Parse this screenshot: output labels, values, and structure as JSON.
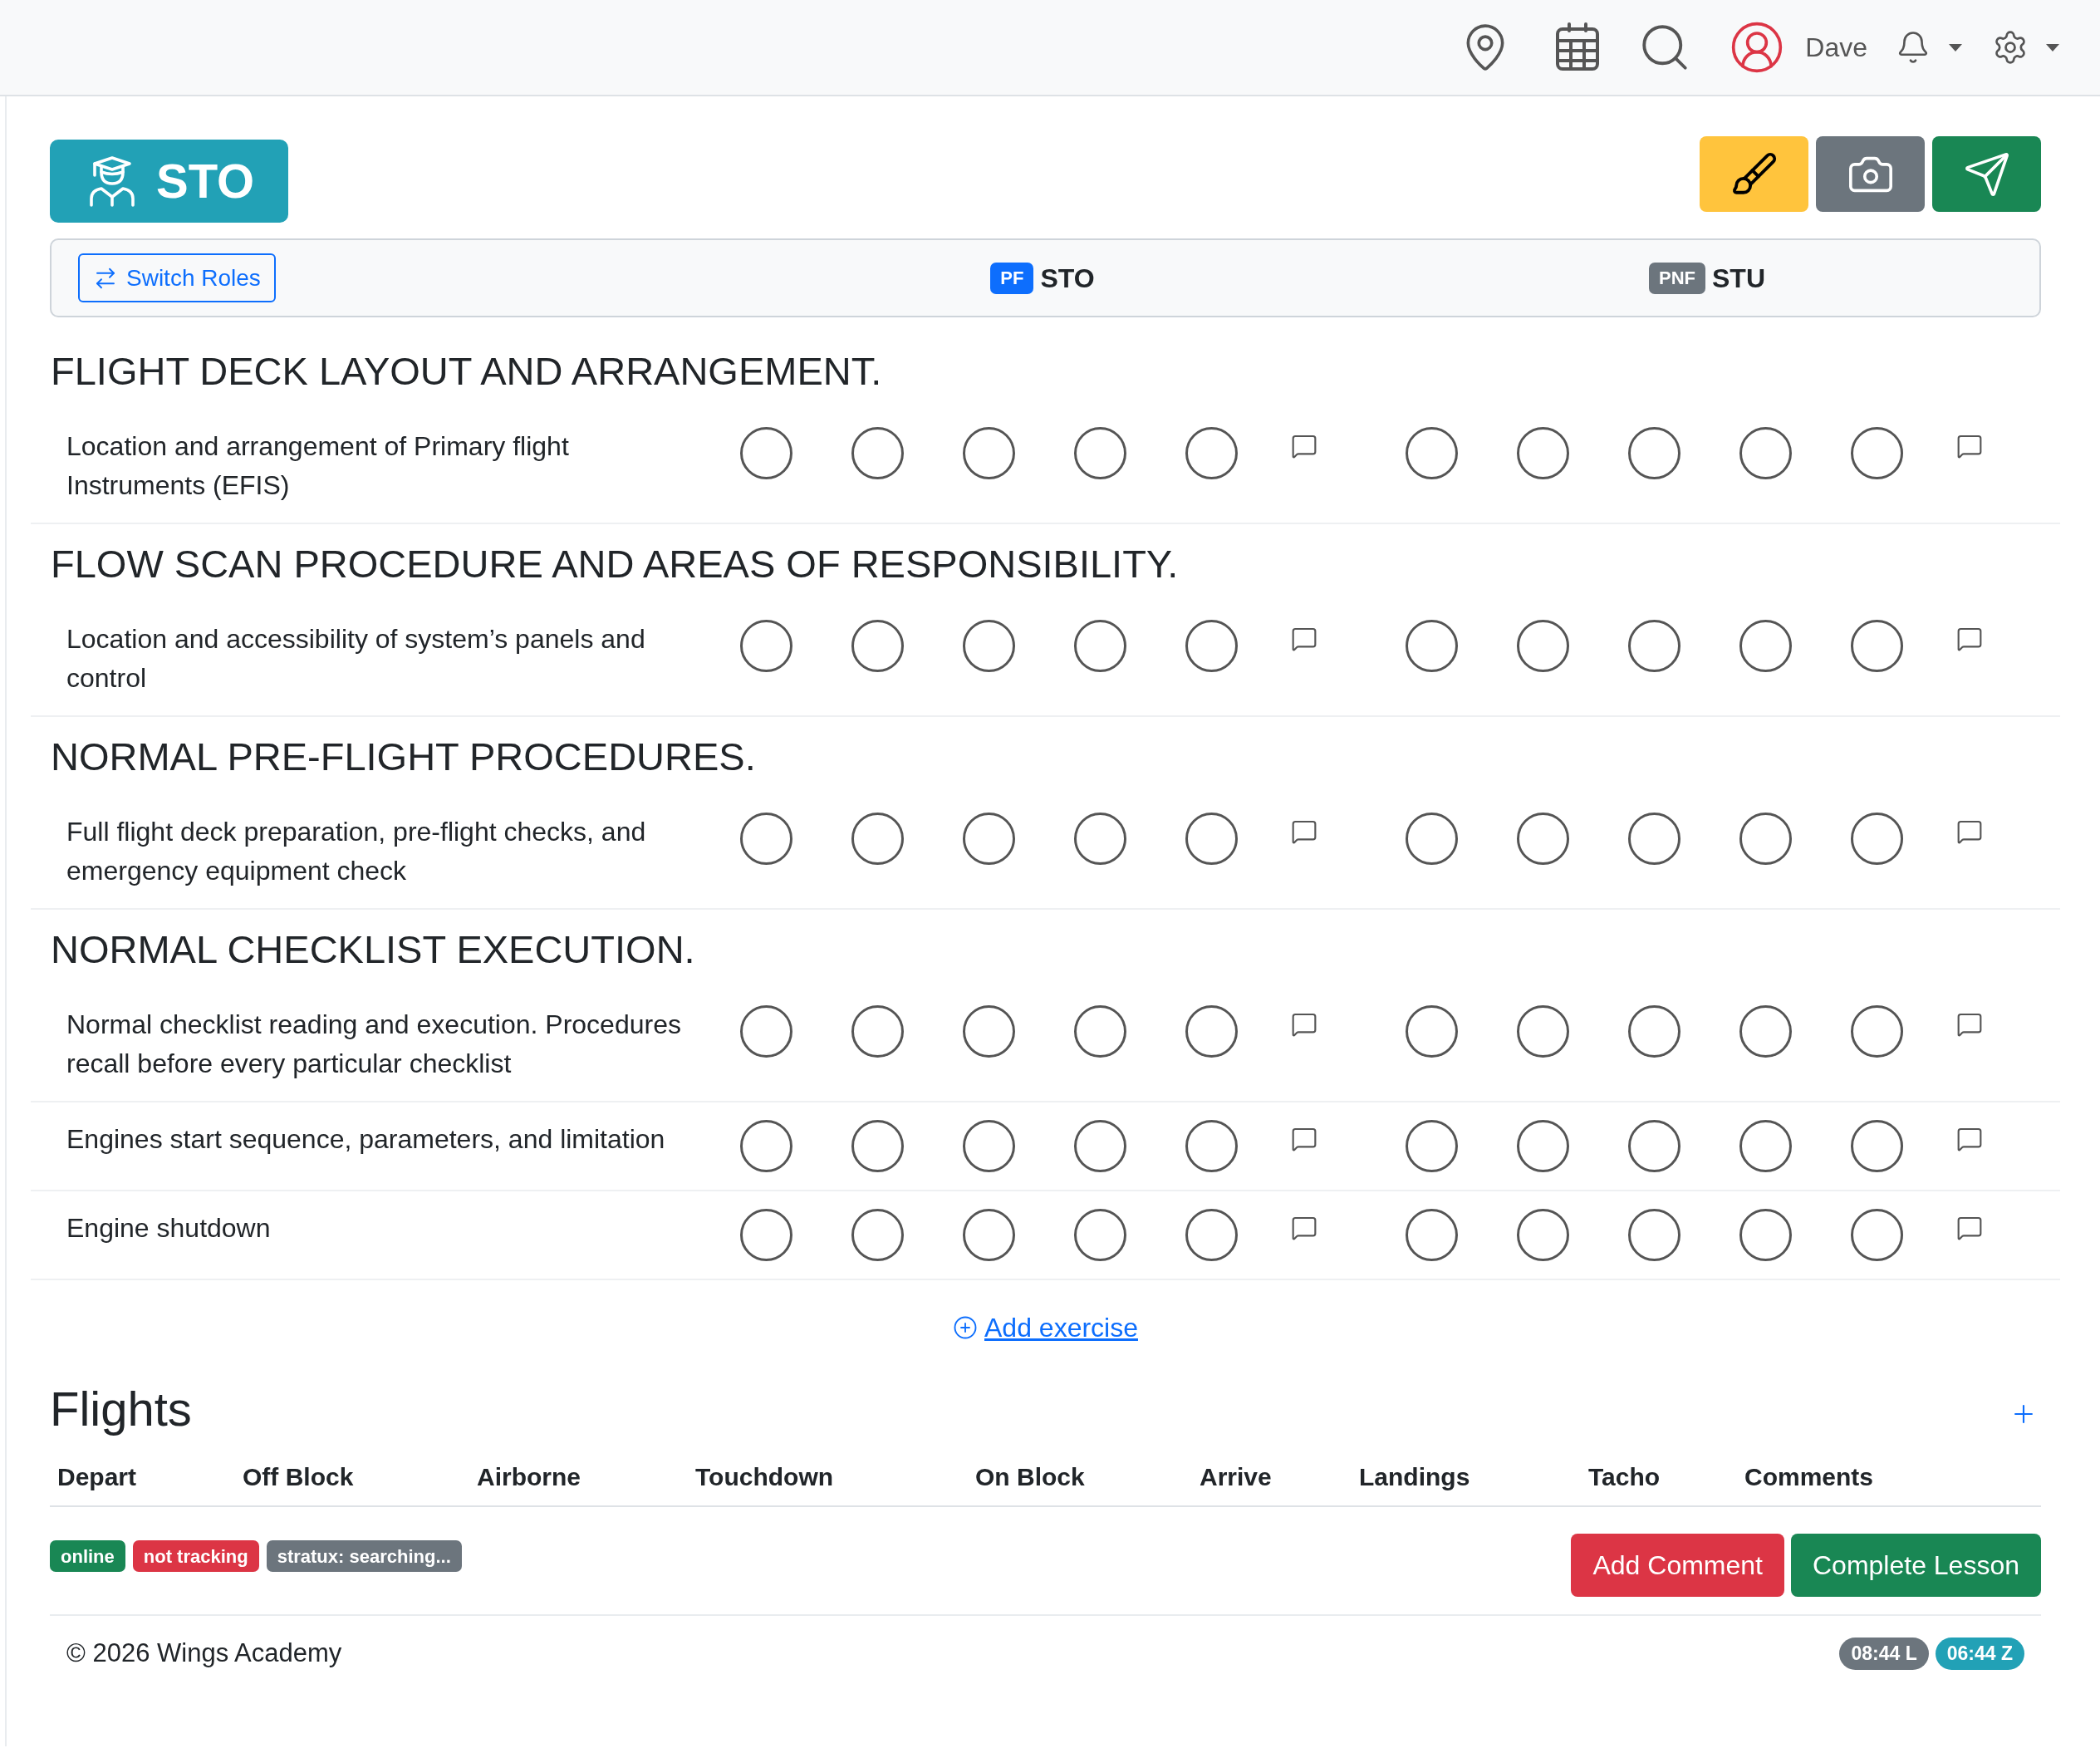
{
  "top_bar": {
    "user_name": "Dave"
  },
  "lesson_badge": {
    "label": "STO"
  },
  "roles": {
    "switch_button": "Switch Roles",
    "columns": [
      {
        "role": "PF",
        "name": "STO",
        "color": "#0d6efd"
      },
      {
        "role": "PNF",
        "name": "STU",
        "color": "#6c757d"
      }
    ]
  },
  "sections": [
    {
      "title": "FLIGHT DECK LAYOUT AND ARRANGEMENT.",
      "exercises": [
        {
          "name": "Location and arrangement of Primary flight Instruments (EFIS)",
          "ratings": [
            [
              {
                "selected": false
              },
              {
                "selected": false
              },
              {
                "selected": false
              },
              {
                "selected": false
              },
              {
                "selected": false
              }
            ],
            [
              {
                "selected": false
              },
              {
                "selected": false
              },
              {
                "selected": false
              },
              {
                "selected": false
              },
              {
                "selected": false
              }
            ]
          ]
        }
      ]
    },
    {
      "title": "FLOW SCAN PROCEDURE AND AREAS OF RESPONSIBILITY.",
      "exercises": [
        {
          "name": "Location and accessibility of system’s panels and control",
          "ratings": [
            [
              {
                "selected": false
              },
              {
                "selected": false
              },
              {
                "selected": false
              },
              {
                "selected": false
              },
              {
                "selected": false
              }
            ],
            [
              {
                "selected": false
              },
              {
                "selected": false
              },
              {
                "selected": false
              },
              {
                "selected": false
              },
              {
                "selected": false
              }
            ]
          ]
        }
      ]
    },
    {
      "title": "NORMAL PRE-FLIGHT PROCEDURES.",
      "exercises": [
        {
          "name": "Full flight deck preparation, pre-flight checks, and emergency equipment check",
          "ratings": [
            [
              {
                "selected": false
              },
              {
                "selected": false
              },
              {
                "selected": false
              },
              {
                "selected": false
              },
              {
                "selected": false
              }
            ],
            [
              {
                "selected": false
              },
              {
                "selected": false
              },
              {
                "selected": false
              },
              {
                "selected": false
              },
              {
                "selected": false
              }
            ]
          ]
        }
      ]
    },
    {
      "title": "NORMAL CHECKLIST EXECUTION.",
      "exercises": [
        {
          "name": "Normal checklist reading and execution. Procedures recall before every particular checklist",
          "ratings": [
            [
              {
                "selected": false
              },
              {
                "selected": false
              },
              {
                "selected": false
              },
              {
                "selected": false
              },
              {
                "selected": false
              }
            ],
            [
              {
                "selected": false
              },
              {
                "selected": false
              },
              {
                "selected": false
              },
              {
                "selected": false
              },
              {
                "selected": false
              }
            ]
          ]
        },
        {
          "name": "Engines start sequence, parameters, and limitation",
          "ratings": [
            [
              {
                "selected": false
              },
              {
                "selected": false
              },
              {
                "selected": false
              },
              {
                "selected": false
              },
              {
                "selected": false
              }
            ],
            [
              {
                "selected": false
              },
              {
                "selected": false
              },
              {
                "selected": false
              },
              {
                "selected": false
              },
              {
                "selected": false
              }
            ]
          ]
        },
        {
          "name": "Engine shutdown",
          "ratings": [
            [
              {
                "selected": false
              },
              {
                "selected": false
              },
              {
                "selected": false
              },
              {
                "selected": false
              },
              {
                "selected": false
              }
            ],
            [
              {
                "selected": false
              },
              {
                "selected": false
              },
              {
                "selected": false
              },
              {
                "selected": false
              },
              {
                "selected": false
              }
            ]
          ]
        }
      ]
    }
  ],
  "add_exercise": "Add exercise",
  "flights": {
    "title": "Flights",
    "columns": [
      "Depart",
      "Off Block",
      "Airborne",
      "Touchdown",
      "On Block",
      "Arrive",
      "Landings",
      "Tacho",
      "Comments"
    ]
  },
  "status_badges": [
    {
      "label": "online",
      "color": "#198754"
    },
    {
      "label": "not tracking",
      "color": "#dc3545"
    },
    {
      "label": "stratux: searching...",
      "color": "#6c757d"
    }
  ],
  "actions": [
    {
      "label": "Add Comment",
      "kind": "danger"
    },
    {
      "label": "Complete Lesson",
      "kind": "success"
    }
  ],
  "footer": {
    "copyright": "© 2026 Wings Academy",
    "clocks": [
      {
        "label": "08:44 L",
        "color": "#6c757d"
      },
      {
        "label": "06:44 Z",
        "color": "#22a1b6"
      }
    ]
  }
}
